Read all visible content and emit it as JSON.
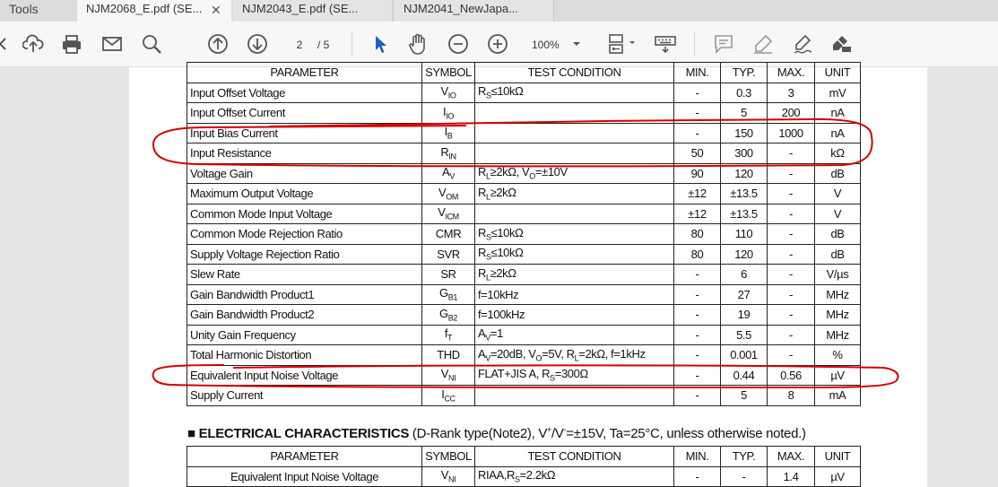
{
  "tabs": [
    {
      "label": "Tools"
    },
    {
      "label": "NJM2068_E.pdf (SE..."
    },
    {
      "label": "NJM2043_E.pdf (SE..."
    },
    {
      "label": "NJM2041_NewJapa..."
    }
  ],
  "toolbar": {
    "page_current": "2",
    "page_total": "/ 5",
    "zoom": "100%",
    "icons": [
      "back-icon",
      "upload-icon",
      "print-icon",
      "mail-icon",
      "search-icon",
      "page-up-icon",
      "page-down-icon",
      "select-arrow-icon",
      "hand-icon",
      "zoom-out-icon",
      "zoom-in-icon",
      "page-fit-icon",
      "keyboard-icon",
      "comment-icon",
      "highlight-icon",
      "sign-icon",
      "redact-icon"
    ]
  },
  "table1": {
    "headers": [
      "PARAMETER",
      "SYMBOL",
      "TEST CONDITION",
      "MIN.",
      "TYP.",
      "MAX.",
      "UNIT"
    ],
    "rows": [
      {
        "param": "Input Offset Voltage",
        "sym": "V",
        "sub": "IO",
        "cond": "R",
        "csub": "S",
        "crest": "≤10kΩ",
        "min": "-",
        "typ": "0.3",
        "max": "3",
        "unit": "mV"
      },
      {
        "param": "Input Offset Current",
        "sym": "I",
        "sub": "IO",
        "cond": "",
        "csub": "",
        "crest": "",
        "min": "-",
        "typ": "5",
        "max": "200",
        "unit": "nA"
      },
      {
        "param": "Input Bias Current",
        "sym": "I",
        "sub": "B",
        "cond": "",
        "csub": "",
        "crest": "",
        "min": "-",
        "typ": "150",
        "max": "1000",
        "unit": "nA"
      },
      {
        "param": "Input Resistance",
        "sym": "R",
        "sub": "IN",
        "cond": "",
        "csub": "",
        "crest": "",
        "min": "50",
        "typ": "300",
        "max": "-",
        "unit": "kΩ"
      },
      {
        "param": "Voltage Gain",
        "sym": "A",
        "sub": "V",
        "cond": "R",
        "csub": "L",
        "crest": "≥2kΩ, V",
        "csub2": "O",
        "crest2": "=±10V",
        "min": "90",
        "typ": "120",
        "max": "-",
        "unit": "dB"
      },
      {
        "param": "Maximum Output Voltage",
        "sym": "V",
        "sub": "OM",
        "cond": "R",
        "csub": "L",
        "crest": "≥2kΩ",
        "min": "±12",
        "typ": "±13.5",
        "max": "-",
        "unit": "V"
      },
      {
        "param": "Common Mode Input Voltage",
        "sym": "V",
        "sub": "ICM",
        "cond": "",
        "csub": "",
        "crest": "",
        "min": "±12",
        "typ": "±13.5",
        "max": "-",
        "unit": "V"
      },
      {
        "param": "Common Mode Rejection Ratio",
        "sym": "CMR",
        "sub": "",
        "cond": "R",
        "csub": "S",
        "crest": "≤10kΩ",
        "min": "80",
        "typ": "110",
        "max": "-",
        "unit": "dB"
      },
      {
        "param": "Supply Voltage Rejection Ratio",
        "sym": "SVR",
        "sub": "",
        "cond": "R",
        "csub": "S",
        "crest": "≤10kΩ",
        "min": "80",
        "typ": "120",
        "max": "-",
        "unit": "dB"
      },
      {
        "param": "Slew Rate",
        "sym": "SR",
        "sub": "",
        "cond": "R",
        "csub": "L",
        "crest": "≥2kΩ",
        "min": "-",
        "typ": "6",
        "max": "-",
        "unit": "V/µs"
      },
      {
        "param": "Gain Bandwidth Product1",
        "sym": "G",
        "sub": "B1",
        "cond": "f=10kHz",
        "csub": "",
        "crest": "",
        "min": "-",
        "typ": "27",
        "max": "-",
        "unit": "MHz"
      },
      {
        "param": "Gain Bandwidth Product2",
        "sym": "G",
        "sub": "B2",
        "cond": "f=100kHz",
        "csub": "",
        "crest": "",
        "min": "-",
        "typ": "19",
        "max": "-",
        "unit": "MHz"
      },
      {
        "param": "Unity Gain Frequency",
        "sym": "f",
        "sub": "T",
        "cond": "A",
        "csub": "V",
        "crest": "=1",
        "min": "-",
        "typ": "5.5",
        "max": "-",
        "unit": "MHz"
      },
      {
        "param": "Total Harmonic Distortion",
        "sym": "THD",
        "sub": "",
        "cond": "A",
        "csub": "V",
        "crest": "=20dB, V",
        "csub2": "O",
        "crest2": "=5V, R",
        "csub3": "L",
        "crest3": "=2kΩ, f=1kHz",
        "min": "-",
        "typ": "0.001",
        "max": "-",
        "unit": "%"
      },
      {
        "param": "Equivalent Input Noise Voltage",
        "sym": "V",
        "sub": "NI",
        "cond": "FLAT+JIS A, R",
        "csub": "S",
        "crest": "=300Ω",
        "min": "-",
        "typ": "0.44",
        "max": "0.56",
        "unit": "µV"
      },
      {
        "param": "Supply Current",
        "sym": "I",
        "sub": "CC",
        "cond": "",
        "csub": "",
        "crest": "",
        "min": "-",
        "typ": "5",
        "max": "8",
        "unit": "mA"
      }
    ]
  },
  "section2": {
    "bold": "■ ELECTRICAL CHARACTERISTICS",
    "rest1": " (D-Rank type(Note2), V",
    "sup1": "+",
    "rest2": "/V",
    "sup2": "-",
    "rest3": "=±15V, Ta=25°C, unless otherwise noted.)"
  },
  "table2": {
    "headers": [
      "PARAMETER",
      "SYMBOL",
      "TEST CONDITION",
      "MIN.",
      "TYP.",
      "MAX.",
      "UNIT"
    ],
    "rows": [
      {
        "param": "Equivalent Input Noise Voltage",
        "sym": "V",
        "sub": "NI",
        "cond": "RIAA,R",
        "csub": "S",
        "crest": "=2.2kΩ",
        "min": "-",
        "typ": "-",
        "max": "1.4",
        "unit": "µV"
      }
    ]
  },
  "annotation_color": "#d40000"
}
